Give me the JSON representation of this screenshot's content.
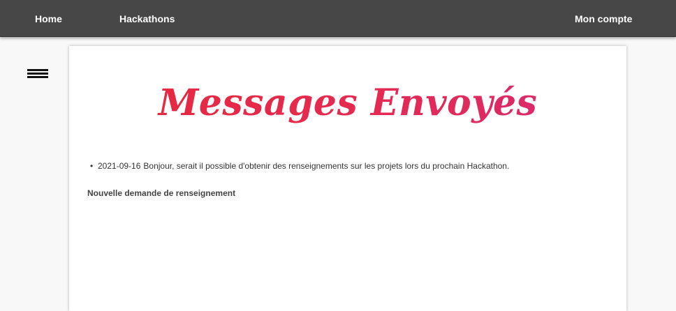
{
  "nav": {
    "home": "Home",
    "hackathons": "Hackathons",
    "account": "Mon compte"
  },
  "main": {
    "title": "Messages Envoyés",
    "messages": [
      {
        "date": "2021-09-16",
        "text": "Bonjour, serait il possible d'obtenir des renseignements sur les projets lors du prochain Hackathon."
      }
    ],
    "new_request_label": "Nouvelle demande de renseignement"
  },
  "colors": {
    "navbar": "#474747",
    "title_start": "#e8283a",
    "title_end": "#d62b72"
  },
  "icons": {
    "menu": "hamburger-menu-icon"
  }
}
